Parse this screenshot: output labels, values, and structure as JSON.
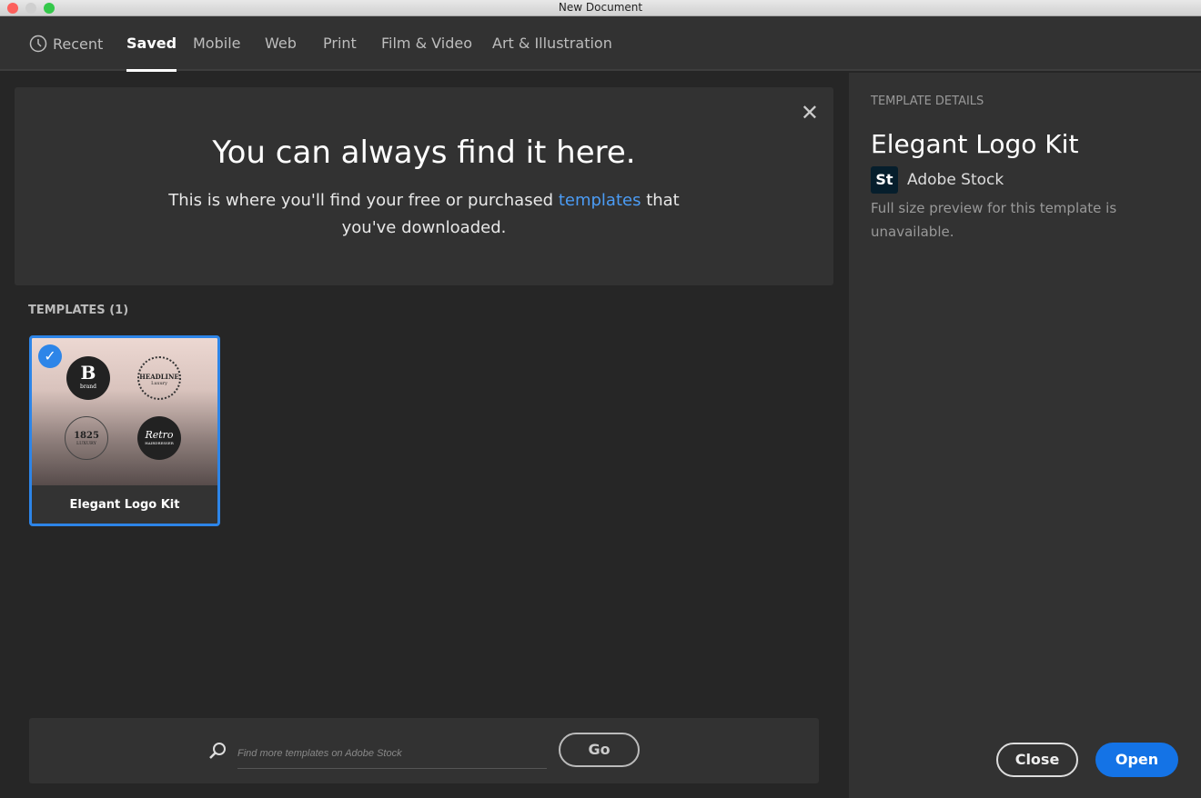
{
  "window": {
    "title": "New Document"
  },
  "tabs": [
    {
      "label": "Recent",
      "icon": "clock-icon"
    },
    {
      "label": "Saved",
      "active": true
    },
    {
      "label": "Mobile"
    },
    {
      "label": "Web"
    },
    {
      "label": "Print"
    },
    {
      "label": "Film & Video"
    },
    {
      "label": "Art & Illustration"
    }
  ],
  "banner": {
    "title": "You can always find it here.",
    "text_before": "This is where you'll find your free or purchased ",
    "link": "templates",
    "text_after": " that you've downloaded."
  },
  "templates": {
    "heading": "TEMPLATES",
    "count": "(1)",
    "items": [
      {
        "name": "Elegant Logo Kit",
        "selected": true,
        "badges": [
          "B",
          "brand",
          "HEADLINE",
          "Luxury",
          "1825",
          "LUXURY",
          "Retro",
          "HAIRDRESSER"
        ]
      }
    ]
  },
  "details": {
    "heading": "TEMPLATE DETAILS",
    "title": "Elegant Logo Kit",
    "source_icon": "St",
    "source": "Adobe Stock",
    "description": "Full size preview for this template is unavailable."
  },
  "search": {
    "placeholder": "Find more templates on Adobe Stock",
    "value": "",
    "go": "Go"
  },
  "actions": {
    "close": "Close",
    "open": "Open"
  },
  "colors": {
    "accent": "#2d85e8",
    "link": "#4b9cf5"
  }
}
